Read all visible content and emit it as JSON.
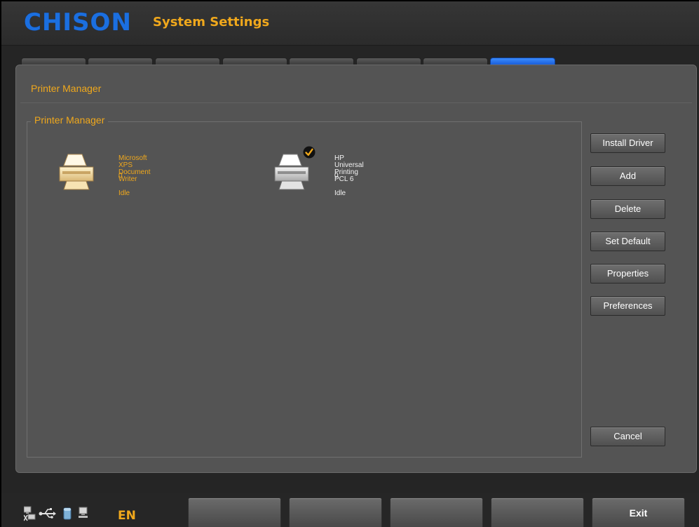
{
  "header": {
    "logo_text": "CHISON",
    "title": "System Settings"
  },
  "tabs": {
    "count": 8,
    "active_index": 7
  },
  "panel": {
    "title": "Printer Manager",
    "group_title": "Printer Manager"
  },
  "printers": [
    {
      "name": "Microsoft XPS Document Writer",
      "jobs": "0",
      "status": "Idle",
      "selected": true,
      "default": false,
      "icon": "printer-icon"
    },
    {
      "name": "HP Universal Printing PCL 6",
      "jobs": "0",
      "status": "Idle",
      "selected": false,
      "default": true,
      "icon": "printer-icon"
    }
  ],
  "actions": {
    "install_driver": "Install Driver",
    "add": "Add",
    "delete": "Delete",
    "set_default": "Set Default",
    "properties": "Properties",
    "preferences": "Preferences",
    "cancel": "Cancel"
  },
  "footer": {
    "language": "EN",
    "exit_label": "Exit",
    "status_icons": [
      "network-disconnected-icon",
      "usb-icon",
      "storage-icon",
      "network-icon"
    ]
  },
  "colors": {
    "accent": "#f0a81c",
    "brand": "#1b6fe0",
    "panel_bg": "#545454",
    "active_tab": "#1a5fd8"
  }
}
